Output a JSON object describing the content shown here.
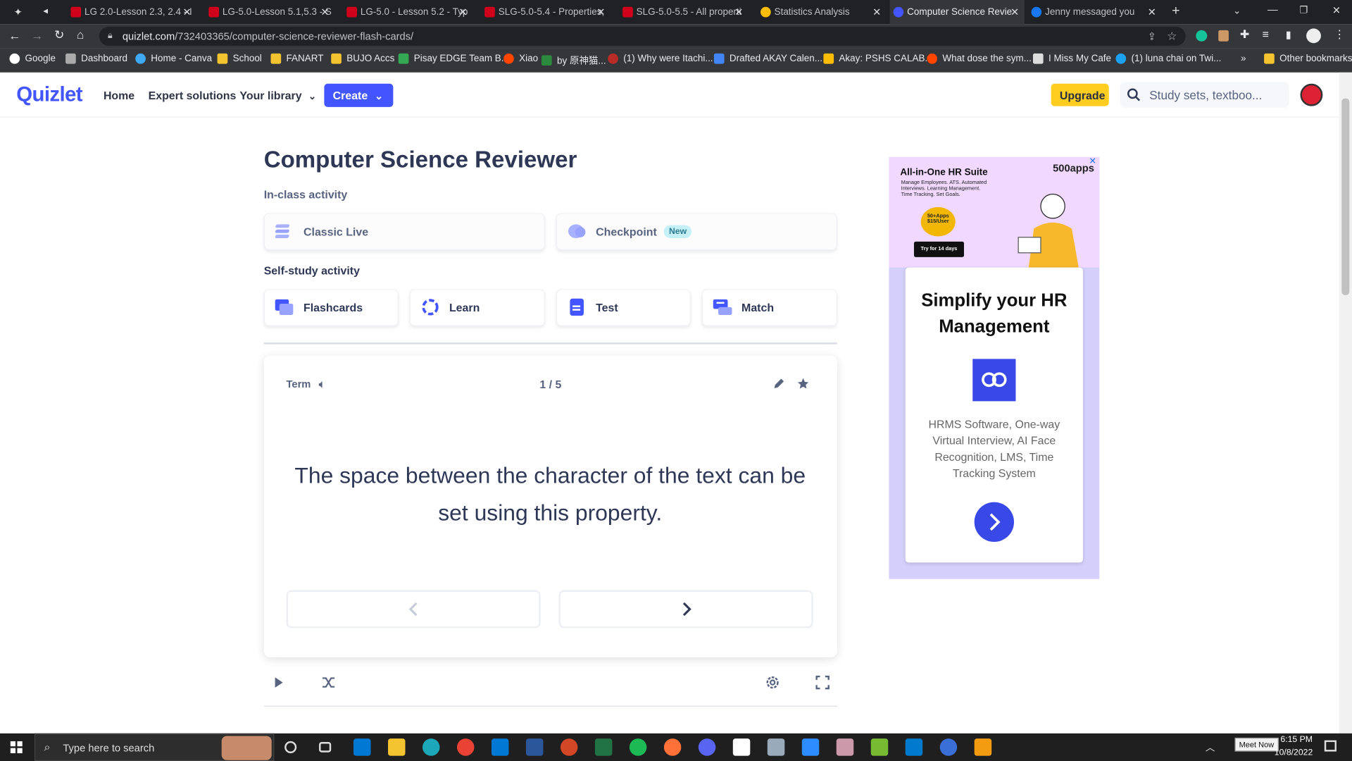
{
  "browser": {
    "tabs": [
      {
        "label": "LG 2.0-Lesson 2.3, 2.4 - I",
        "favicon": "pdf-icon"
      },
      {
        "label": "LG-5.0-Lesson 5.1,5.3 - S",
        "favicon": "pdf-icon"
      },
      {
        "label": "LG-5.0 - Lesson 5.2 - Typ",
        "favicon": "pdf-icon"
      },
      {
        "label": "SLG-5.0-5.4 - Properties,",
        "favicon": "pdf-icon"
      },
      {
        "label": "SLG-5.0-5.5 - All properti",
        "favicon": "pdf-icon"
      },
      {
        "label": "Statistics Analysis",
        "favicon": "google-icon"
      },
      {
        "label": "Computer Science Revie",
        "favicon": "quizlet-icon",
        "active": true
      },
      {
        "label": "Jenny messaged you",
        "favicon": "facebook-icon"
      }
    ],
    "url_domain": "quizlet.com",
    "url_path": "/732403365/computer-science-reviewer-flash-cards/",
    "bookmarks": [
      "Google",
      "Dashboard",
      "Home - Canva",
      "School",
      "FANART",
      "BUJO Accs",
      "Pisay EDGE Team B...",
      "Xiao",
      "by 原神猫...",
      "(1) Why were Itachi...",
      "Drafted AKAY Calen...",
      "Akay: PSHS CALAB...",
      "What dose the sym...",
      "I Miss My Cafe",
      "(1) luna chai on Twi..."
    ],
    "other_bookmarks": "Other bookmarks"
  },
  "header": {
    "logo": "Quizlet",
    "nav": [
      "Home",
      "Expert solutions",
      "Your library"
    ],
    "create_label": "Create",
    "upgrade_label": "Upgrade",
    "search_placeholder": "Study sets, textboo..."
  },
  "page": {
    "title": "Computer Science Reviewer",
    "in_class_label": "In-class activity",
    "in_class": [
      {
        "label": "Classic Live",
        "icon": "classic-live-icon"
      },
      {
        "label": "Checkpoint",
        "icon": "checkpoint-icon",
        "badge": "New"
      }
    ],
    "self_study_label": "Self-study activity",
    "self_study": [
      {
        "label": "Flashcards",
        "icon": "flashcards-icon"
      },
      {
        "label": "Learn",
        "icon": "learn-icon"
      },
      {
        "label": "Test",
        "icon": "test-icon"
      },
      {
        "label": "Match",
        "icon": "match-icon"
      }
    ]
  },
  "flashcard": {
    "side_label": "Term",
    "counter": "1 / 5",
    "text": "The space between the character of the text can be set using this property."
  },
  "ad": {
    "top_title": "All-in-One HR Suite",
    "top_desc": "Manage Employees. ATS. Automated Interviews. Learning Management. Time Tracking. Set Goals.",
    "brand": "500apps",
    "price_badge": "50+Apps $15/User",
    "trial": "Try for 14 days",
    "headline": "Simplify your HR Management",
    "description": "HRMS Software, One-way Virtual Interview, AI Face Recognition, LMS, Time Tracking System"
  },
  "taskbar": {
    "search_placeholder": "Type here to search",
    "meet_now": "Meet Now",
    "time": "6:15 PM",
    "date": "10/8/2022"
  },
  "colors": {
    "brand": "#4255ff",
    "upgrade": "#ffcd1f",
    "text": "#2e3856"
  }
}
